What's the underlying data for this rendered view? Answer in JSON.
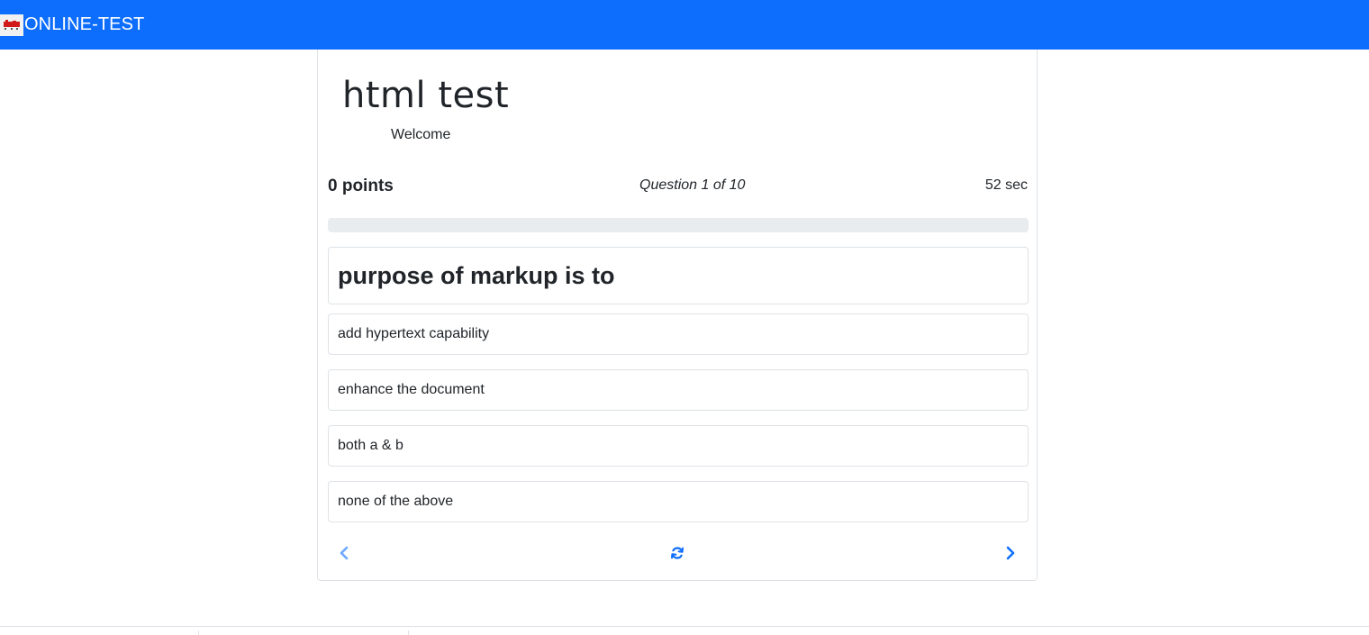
{
  "navbar": {
    "brand_text": "ONLINE-TEST",
    "logo_icon": "brand-logo-icon",
    "background_color": "#0d6efd"
  },
  "quiz": {
    "title": "html test",
    "welcome": "Welcome",
    "points": "0 points",
    "question_counter": "Question 1 of 10",
    "timer": "52 sec",
    "progress_fraction": 0,
    "question": "purpose of markup is to",
    "options": [
      "add hypertext capability",
      "enhance the document",
      "both a & b",
      "none of the above"
    ]
  },
  "controls": {
    "prev_icon": "chevron-left-icon",
    "reload_icon": "refresh-icon",
    "next_icon": "chevron-right-icon",
    "accent_color": "#0d6efd"
  }
}
